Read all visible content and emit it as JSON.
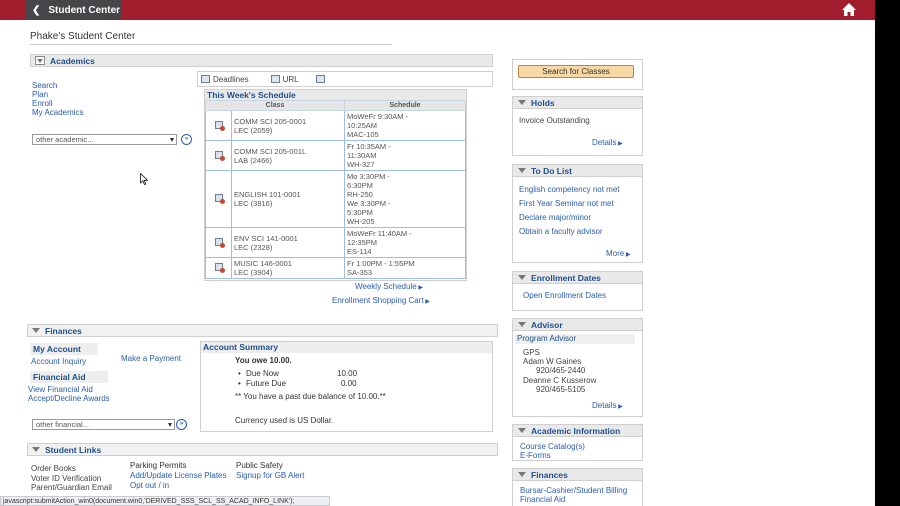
{
  "header": {
    "back_label": "Student Center"
  },
  "page_title": "Phake's Student Center",
  "academics": {
    "title": "Academics",
    "links": [
      "Search",
      "Plan",
      "Enroll",
      "My Academics"
    ],
    "select_value": "other academic...",
    "toolbar": {
      "deadlines": "Deadlines",
      "url": "URL"
    },
    "schedule": {
      "title": "This Week's Schedule",
      "col_class": "Class",
      "col_schedule": "Schedule",
      "rows": [
        {
          "cls1": "COMM SCI 205-0001",
          "cls2": "LEC (2059)",
          "s": [
            "MoWeFr 9:30AM -",
            "10:25AM",
            "MAC-105"
          ]
        },
        {
          "cls1": "COMM SCI 205-001L",
          "cls2": "LAB (2466)",
          "s": [
            "Fr 10:35AM -",
            "11:30AM",
            "WH-327"
          ]
        },
        {
          "cls1": "ENGLISH 101-0001",
          "cls2": "LEC (3816)",
          "s": [
            "Mo 3:30PM -",
            "6:30PM",
            "RH-250",
            "We 3:30PM -",
            "5:30PM",
            "WH-205"
          ]
        },
        {
          "cls1": "ENV SCI 141-0001",
          "cls2": "LEC (2328)",
          "s": [
            "MoWeFr 11:40AM -",
            "12:35PM",
            "ES-114"
          ]
        },
        {
          "cls1": "MUSIC 146-0001",
          "cls2": "LEC (3904)",
          "s": [
            "Fr 1:00PM - 1:55PM",
            "SA-353"
          ]
        }
      ],
      "weekly_link": "Weekly Schedule",
      "cart_link": "Enrollment Shopping Cart"
    }
  },
  "finances": {
    "title": "Finances",
    "my_account": "My Account",
    "account_inquiry": "Account Inquiry",
    "make_payment": "Make a Payment",
    "financial_aid": "Financial Aid",
    "view_aid": "View Financial Aid",
    "accept_awards": "Accept/Decline Awards",
    "select_value": "other financial...",
    "summary": {
      "title": "Account Summary",
      "owe": "You owe 10.00.",
      "due_now_label": "Due Now",
      "due_now_value": "10.00",
      "future_due_label": "Future Due",
      "future_due_value": "0.00",
      "past_due": "** You have a past due balance of 10.00.**",
      "currency": "Currency used is US Dollar."
    }
  },
  "student_links": {
    "title": "Student Links",
    "col1": [
      "Order Books",
      "Voter ID Verification",
      "Parent/Guardian Email"
    ],
    "col2_title": "Parking Permits",
    "col2": [
      "Add/Update License Plates",
      "Opt out / in"
    ],
    "col3_title": "Public Safety",
    "col3": [
      "Signup for GB Alert"
    ]
  },
  "right": {
    "search_button": "Search for Classes",
    "holds": {
      "title": "Holds",
      "item": "Invoice Outstanding",
      "details": "Details"
    },
    "todo": {
      "title": "To Do List",
      "items": [
        "English competency not met",
        "First Year Seminar not met",
        "Declare major/minor",
        "Obtain a faculty advisor"
      ],
      "more": "More"
    },
    "enrollment": {
      "title": "Enrollment Dates",
      "link": "Open Enrollment Dates"
    },
    "advisor": {
      "title": "Advisor",
      "program": "Program Advisor",
      "org": "GPS",
      "name1": "Adam W Gaines",
      "phone1": "920/465-2440",
      "name2": "Deanne C Kusserow",
      "phone2": "920/465-5105",
      "details": "Details"
    },
    "academic_info": {
      "title": "Academic Information",
      "links": [
        "Course Catalog(s)",
        "E-Forms"
      ]
    },
    "finances": {
      "title": "Finances",
      "links": [
        "Bursar-Cashier/Student Billing",
        "Financial Aid"
      ]
    }
  },
  "status_bar": "javascript:submitAction_win0(document.win0,'DERIVED_SSS_SCL_SS_ACAD_INFO_LINK');"
}
